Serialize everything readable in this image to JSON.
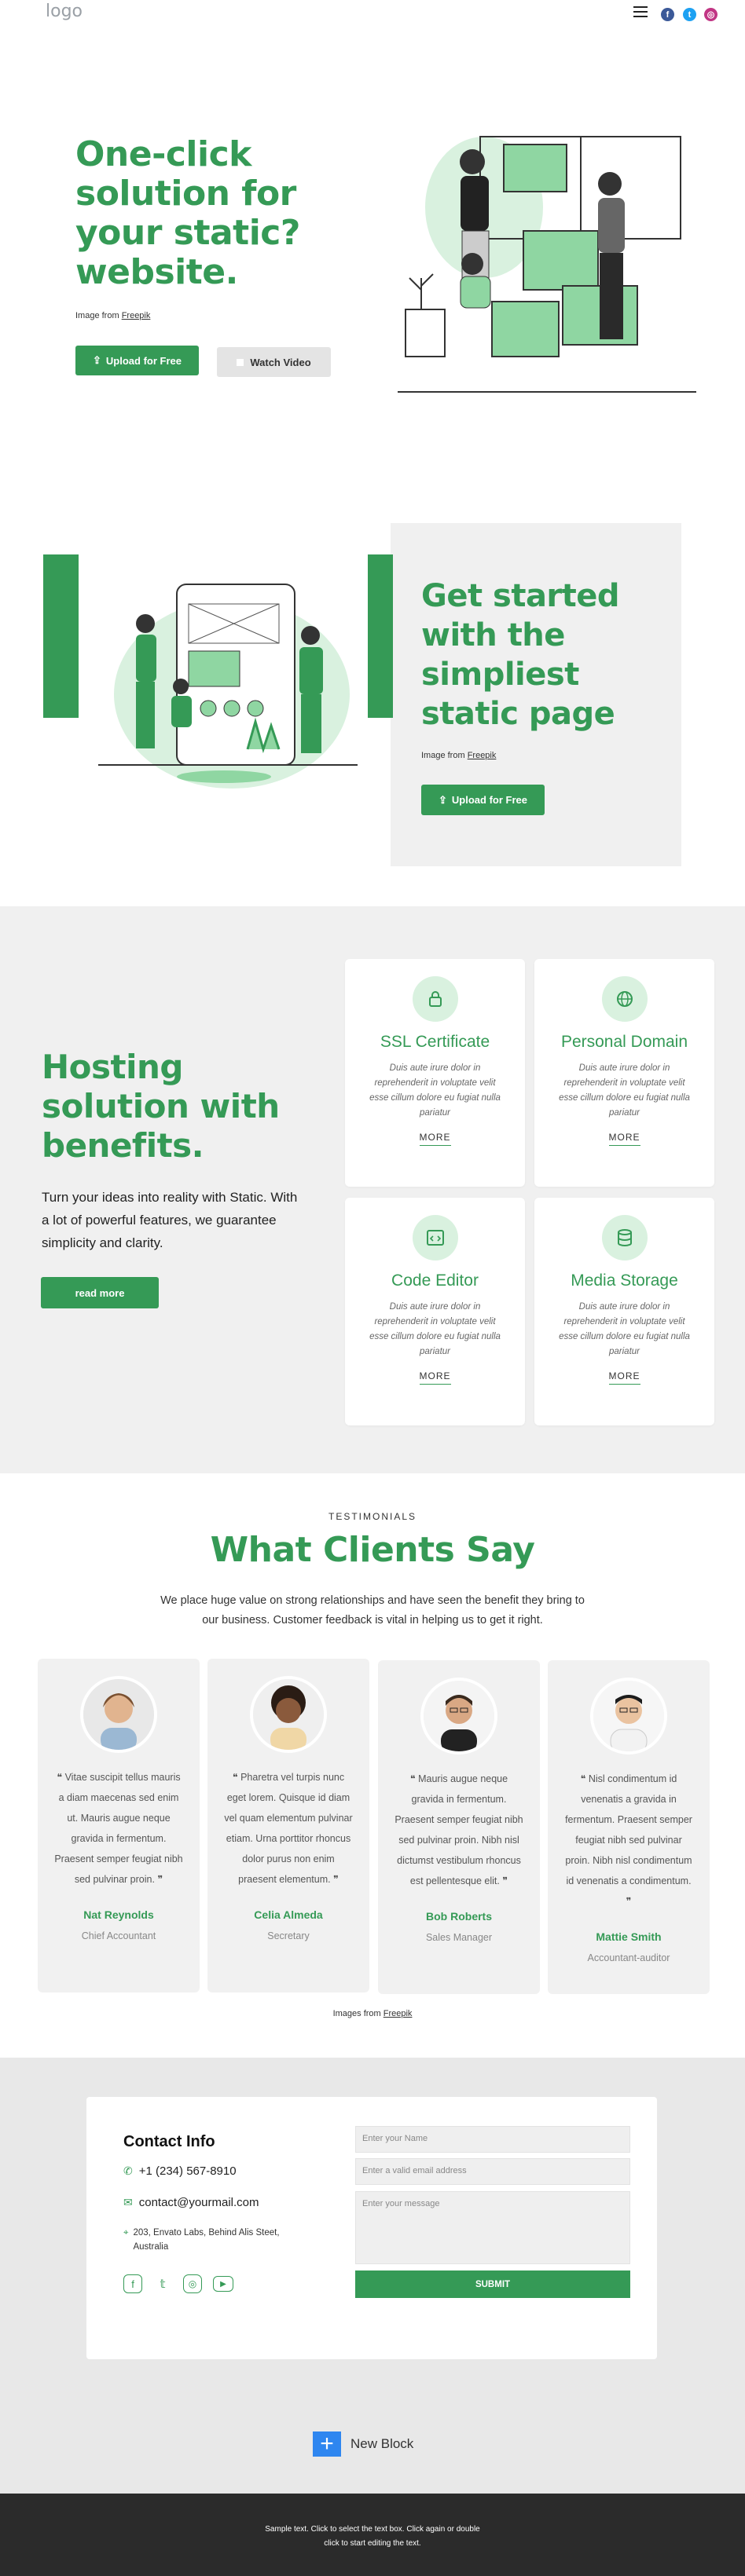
{
  "header": {
    "logo": "logo",
    "menu_icon": "hamburger-icon",
    "social": [
      {
        "name": "facebook-icon",
        "color": "#3b5998",
        "glyph": "f"
      },
      {
        "name": "twitter-icon",
        "color": "#1da1f2",
        "glyph": "t"
      },
      {
        "name": "instagram-icon",
        "color": "#c13584",
        "glyph": "◎"
      }
    ]
  },
  "hero": {
    "title_lines": [
      "One-click",
      "solution for",
      "your static?",
      "website."
    ],
    "caption_prefix": "Image from ",
    "caption_link": "Freepik",
    "upload_button": "Upload for Free",
    "video_button": "Watch Video"
  },
  "start": {
    "title_lines": [
      "Get started",
      "with the",
      "simpliest",
      "static page"
    ],
    "caption_prefix": "Image from ",
    "caption_link": "Freepik",
    "upload_button": "Upload for Free"
  },
  "hosting": {
    "title_lines": [
      "Hosting",
      "solution with",
      "benefits."
    ],
    "description": "Turn your ideas into reality with Static. With a lot of powerful features, we guarantee simplicity and clarity.",
    "button": "read more",
    "features": [
      {
        "title": "SSL Certificate",
        "icon": "lock-icon",
        "text": "Duis aute irure dolor in reprehenderit in voluptate velit esse cillum dolore eu fugiat nulla pariatur",
        "more": "MORE"
      },
      {
        "title": "Personal Domain",
        "icon": "globe-icon",
        "text": "Duis aute irure dolor in reprehenderit in voluptate velit esse cillum dolore eu fugiat nulla pariatur",
        "more": "MORE"
      },
      {
        "title": "Code Editor",
        "icon": "code-icon",
        "text": "Duis aute irure dolor in reprehenderit in voluptate velit esse cillum dolore eu fugiat nulla pariatur",
        "more": "MORE"
      },
      {
        "title": "Media Storage",
        "icon": "database-icon",
        "text": "Duis aute irure dolor in reprehenderit in voluptate velit esse cillum dolore eu fugiat nulla pariatur",
        "more": "MORE"
      }
    ]
  },
  "testimonials": {
    "eyebrow": "TESTIMONIALS",
    "title": "What Clients Say",
    "intro": "We place huge value on strong relationships and have seen the benefit they bring to our business. Customer feedback is vital in helping us to get it right.",
    "items": [
      {
        "quote": "Vitae suscipit tellus mauris a diam maecenas sed enim ut. Mauris augue neque gravida in fermentum. Praesent semper feugiat nibh sed pulvinar proin.",
        "name": "Nat Reynolds",
        "role": "Chief Accountant"
      },
      {
        "quote": "Pharetra vel turpis nunc eget lorem. Quisque id diam vel quam elementum pulvinar etiam. Urna porttitor rhoncus dolor purus non enim praesent elementum.",
        "name": "Celia Almeda",
        "role": "Secretary"
      },
      {
        "quote": "Mauris augue neque gravida in fermentum. Praesent semper feugiat nibh sed pulvinar proin. Nibh nisl dictumst vestibulum rhoncus est pellentesque elit.",
        "name": "Bob Roberts",
        "role": "Sales Manager"
      },
      {
        "quote": "Nisl condimentum id venenatis a gravida in fermentum. Praesent semper feugiat nibh sed pulvinar proin. Nibh nisl condimentum id venenatis a condimentum.",
        "name": "Mattie Smith",
        "role": "Accountant-auditor"
      }
    ],
    "caption_prefix": "Images from ",
    "caption_link": "Freepik"
  },
  "contact": {
    "title": "Contact Info",
    "phone": "+1 (234) 567-8910",
    "email": "contact@yourmail.com",
    "address": "203, Envato Labs, Behind Alis Steet, Australia",
    "name_placeholder": "Enter your Name",
    "email_placeholder": "Enter a valid email address",
    "message_placeholder": "Enter your message",
    "submit": "SUBMIT",
    "social_icons": [
      "facebook-icon",
      "twitter-icon",
      "instagram-icon",
      "youtube-icon"
    ]
  },
  "new_block": {
    "label": "New Block"
  },
  "footer": {
    "text_line1": "Sample text. Click to select the text box. Click again or double",
    "text_line2": "click to start editing the text."
  },
  "colors": {
    "accent": "#359a56",
    "light_green": "#d9f1df",
    "section_gray": "#f0f0f0",
    "footer_dark": "#2b2b2b"
  }
}
